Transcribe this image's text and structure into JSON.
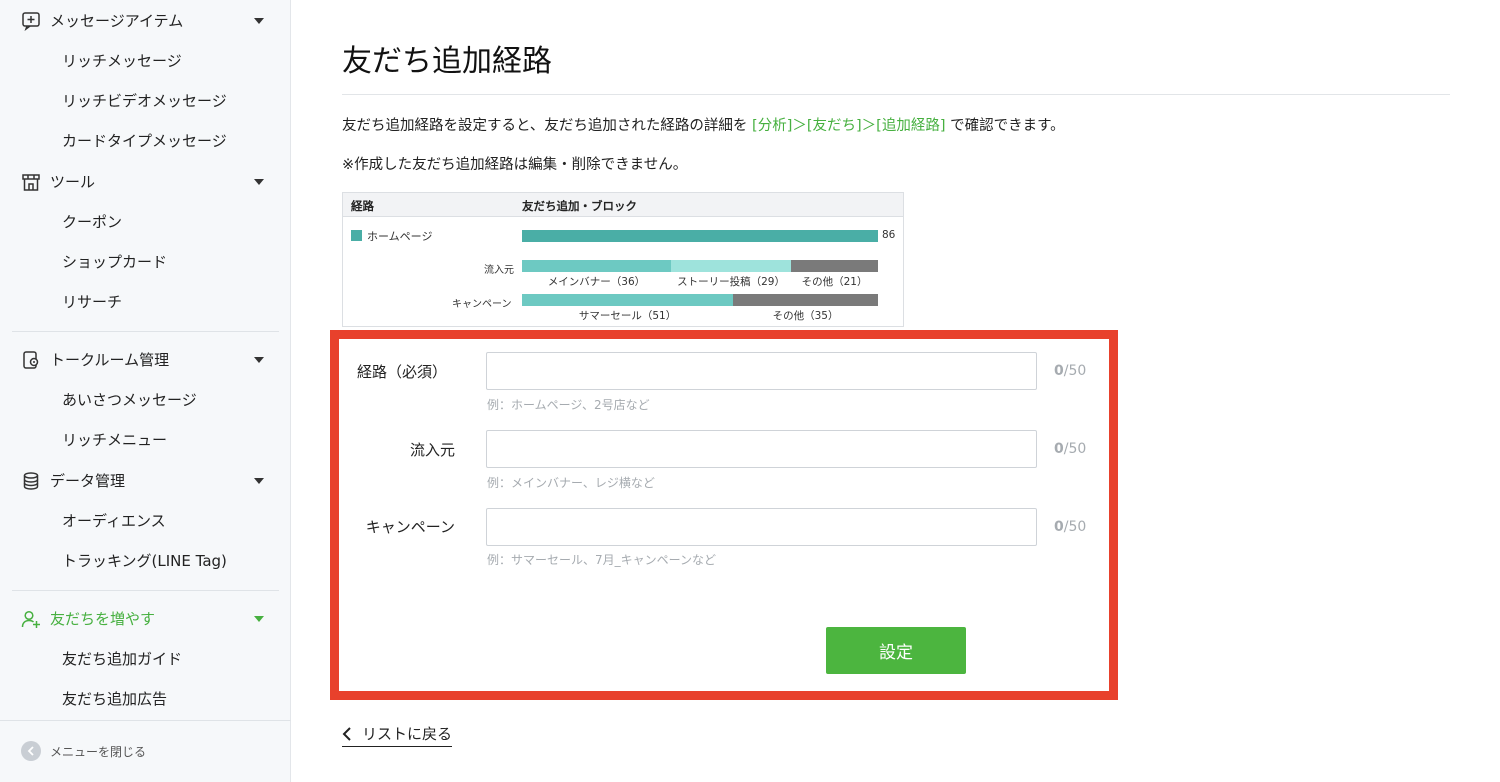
{
  "sidebar": {
    "groups": [
      {
        "label": "メッセージアイテム",
        "icon": "message-add-icon"
      },
      {
        "label": "ツール",
        "icon": "store-icon"
      },
      {
        "label": "トークルーム管理",
        "icon": "chat-settings-icon"
      },
      {
        "label": "データ管理",
        "icon": "database-icon"
      },
      {
        "label": "友だちを増やす",
        "icon": "add-friend-icon"
      }
    ],
    "items": [
      "リッチメッセージ",
      "リッチビデオメッセージ",
      "カードタイプメッセージ",
      "クーポン",
      "ショップカード",
      "リサーチ",
      "あいさつメッセージ",
      "リッチメニュー",
      "オーディエンス",
      "トラッキング(LINE Tag)",
      "友だち追加ガイド",
      "友だち追加広告"
    ],
    "collapse_label": "メニューを閉じる",
    "active_color": "#47b040"
  },
  "main": {
    "title": "友だち追加経路",
    "description_prefix": "友だち追加経路を設定すると、友だち追加された経路の詳細を ",
    "description_link": "[分析]＞[友だち]＞[追加経路]",
    "description_suffix": " で確認できます。",
    "note": "※作成した友だち追加経路は編集・削除できません。"
  },
  "example": {
    "header_route": "経路",
    "header_add_block": "友だち追加・ブロック",
    "route_name": "ホームページ",
    "total": "86",
    "source_label": "流入元",
    "campaign_label": "キャンペーン",
    "source_segments": [
      {
        "label": "メインバナー（36）",
        "value": 36,
        "color": "#6dc9c2"
      },
      {
        "label": "ストーリー投稿（29）",
        "value": 29,
        "color": "#9ee3dc"
      },
      {
        "label": "その他（21）",
        "value": 21,
        "color": "#7a7a7a"
      }
    ],
    "campaign_segments": [
      {
        "label": "サマーセール（51）",
        "value": 51,
        "color": "#6dc9c2"
      },
      {
        "label": "その他（35）",
        "value": 35,
        "color": "#7a7a7a"
      }
    ],
    "total_color": "#4aaea6"
  },
  "form": {
    "route_label": "経路（必須）",
    "route_value": "",
    "route_hint": "例：ホームページ、2号店など",
    "route_count": "0",
    "route_max": "/50",
    "source_label": "流入元",
    "source_value": "",
    "source_hint": "例：メインバナー、レジ横など",
    "source_count": "0",
    "source_max": "/50",
    "campaign_label": "キャンペーン",
    "campaign_value": "",
    "campaign_hint": "例：サマーセール、7月_キャンペーンなど",
    "campaign_count": "0",
    "campaign_max": "/50",
    "submit_label": "設定",
    "highlight_color": "#e8412c"
  },
  "back_link": "リストに戻る"
}
